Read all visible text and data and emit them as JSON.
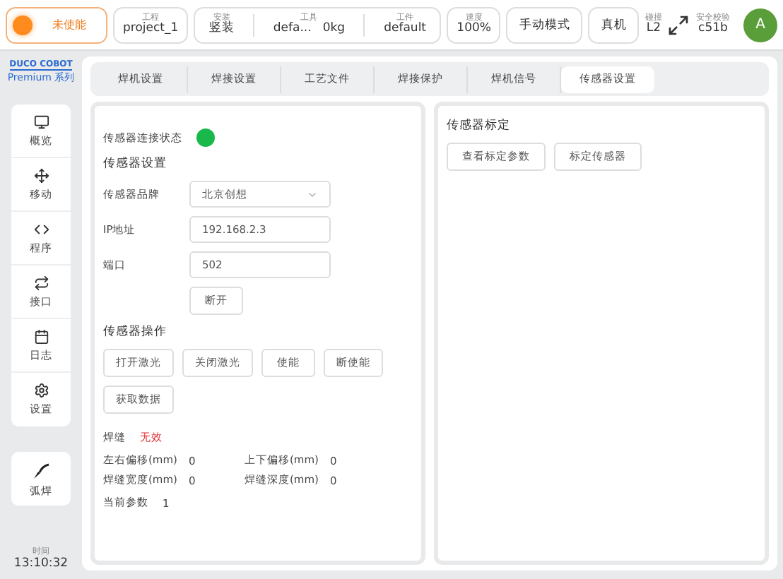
{
  "status_bar": {
    "enable": {
      "label": "未使能",
      "enabled": false
    },
    "groups": [
      {
        "items": [
          {
            "label": "工程",
            "value": "project_1"
          }
        ]
      },
      {
        "items": [
          {
            "label": "安装",
            "value": "竖装"
          },
          {
            "label": "工具",
            "value": "defa...",
            "extra": "0kg"
          },
          {
            "label": "工件",
            "value": "default"
          }
        ]
      },
      {
        "items": [
          {
            "label": "速度",
            "value": "100%"
          }
        ]
      }
    ],
    "buttons": [
      "手动模式",
      "真机"
    ],
    "collision": {
      "label": "碰撞",
      "value": "L2"
    },
    "safety": {
      "label": "安全校验",
      "value": "c51b"
    },
    "avatar": "A"
  },
  "logo": {
    "title": "DUCO COBOT",
    "subtitle": "Premium 系列"
  },
  "sidebar": {
    "items": [
      {
        "kind": "monitor",
        "label": "概览"
      },
      {
        "kind": "move",
        "label": "移动"
      },
      {
        "kind": "code",
        "label": "程序"
      },
      {
        "kind": "repeat",
        "label": "接口"
      },
      {
        "kind": "calendar",
        "label": "日志"
      },
      {
        "kind": "settings",
        "label": "设置"
      }
    ],
    "app": {
      "kind": "torch",
      "label": "弧焊"
    },
    "clock": {
      "label": "时间",
      "value": "13:10:32"
    }
  },
  "tabs": [
    {
      "label": "焊机设置",
      "selected": false
    },
    {
      "label": "焊接设置",
      "selected": false
    },
    {
      "label": "工艺文件",
      "selected": false
    },
    {
      "label": "焊接保护",
      "selected": false
    },
    {
      "label": "焊机信号",
      "selected": false
    },
    {
      "label": "传感器设置",
      "selected": true
    }
  ],
  "left_panel": {
    "connection": {
      "label": "传感器连接状态",
      "connected": true
    },
    "settings_title": "传感器设置",
    "fields": [
      {
        "kind": "select",
        "label": "传感器品牌",
        "value": "北京创想"
      },
      {
        "kind": "input",
        "label": "IP地址",
        "value": "192.168.2.3"
      },
      {
        "kind": "input",
        "label": "端口",
        "value": "502"
      }
    ],
    "disconnect_button": "断开",
    "operations_title": "传感器操作",
    "operation_buttons": [
      "打开激光",
      "关闭激光",
      "使能",
      "断使能",
      "获取数据"
    ],
    "seam": {
      "label": "焊缝",
      "status": "无效",
      "valid": false
    },
    "readings": [
      {
        "label": "左右偏移(mm)",
        "value": "0"
      },
      {
        "label": "上下偏移(mm)",
        "value": "0"
      },
      {
        "label": "焊缝宽度(mm)",
        "value": "0"
      },
      {
        "label": "焊缝深度(mm)",
        "value": "0"
      }
    ],
    "current": {
      "label": "当前参数",
      "value": "1"
    }
  },
  "right_panel": {
    "title": "传感器标定",
    "buttons": [
      "查看标定参数",
      "标定传感器"
    ]
  }
}
